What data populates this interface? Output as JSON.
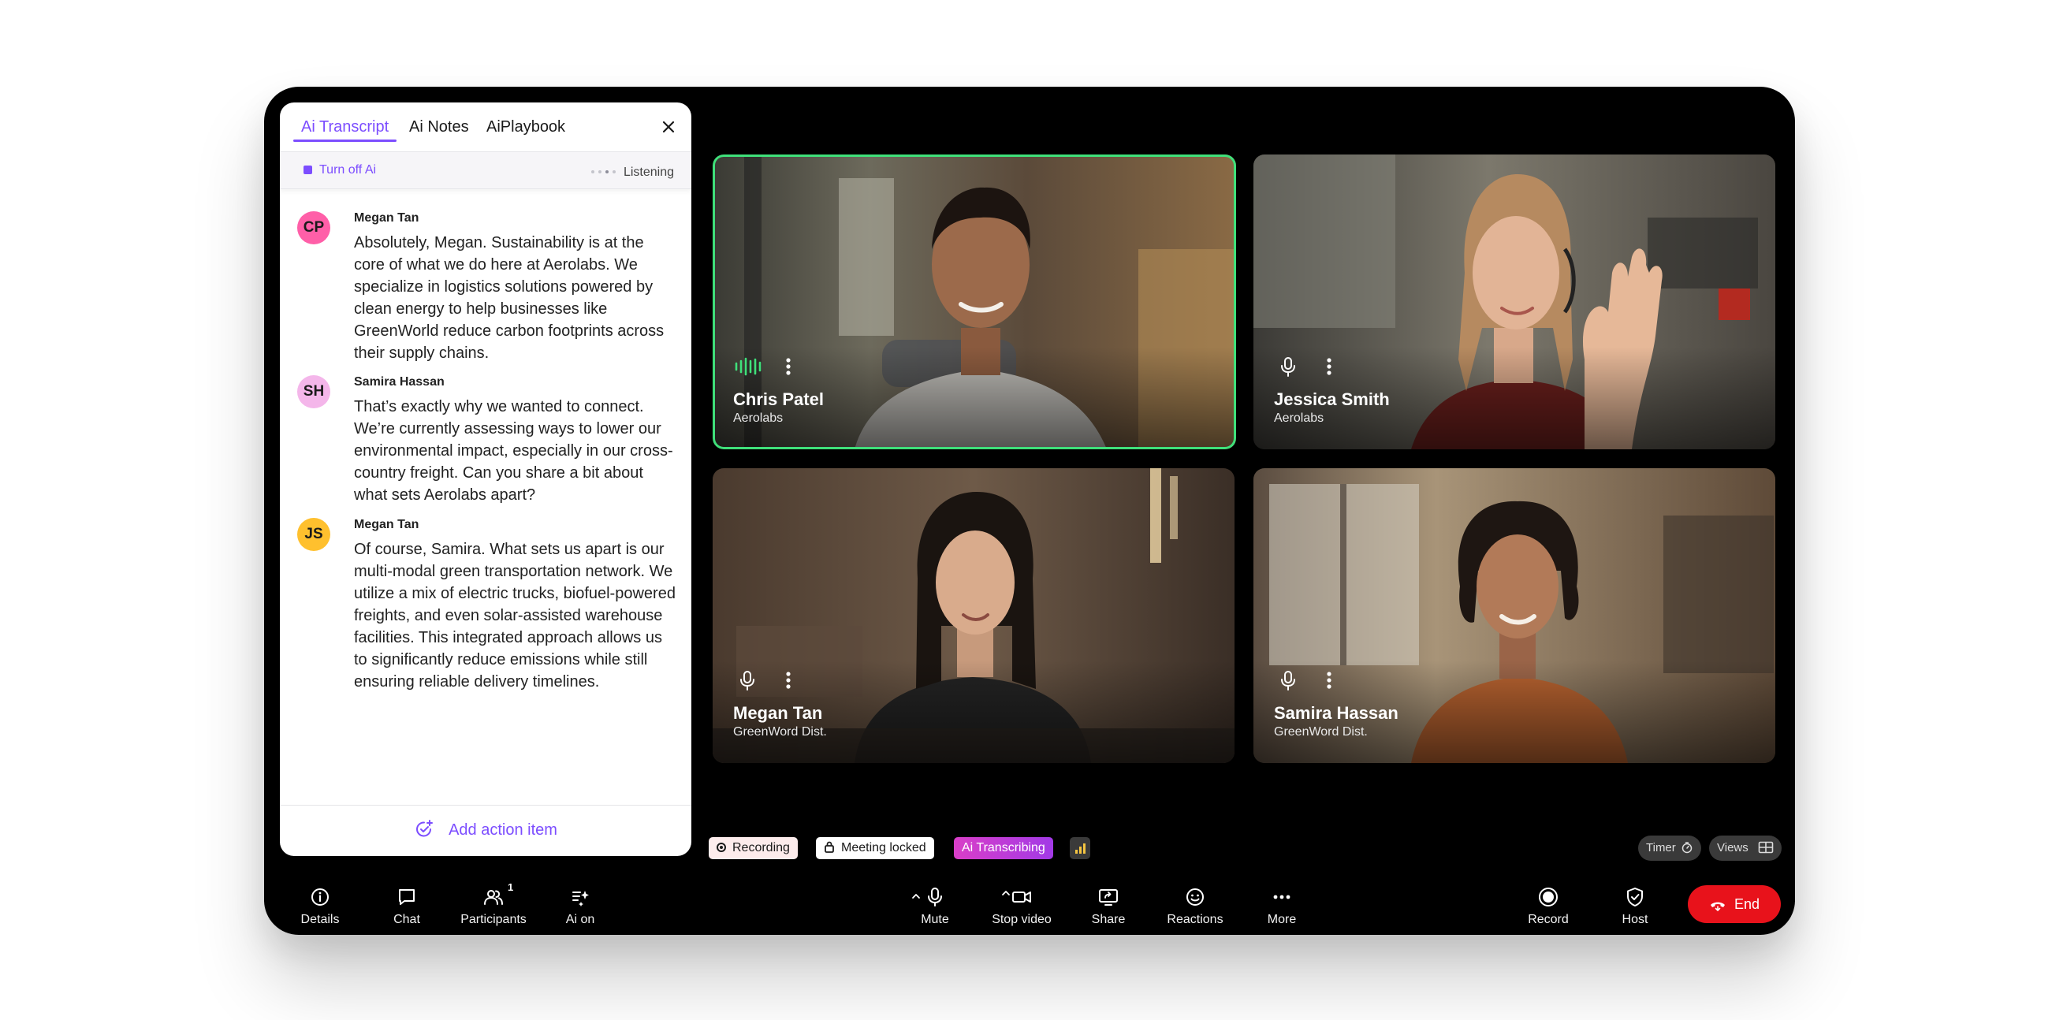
{
  "side_panel": {
    "tabs": [
      {
        "label": "Ai Transcript",
        "active": true
      },
      {
        "label": "Ai Notes",
        "active": false
      },
      {
        "label": "AiPlaybook",
        "active": false
      }
    ],
    "turn_off_label": "Turn off Ai",
    "status_label": "Listening",
    "messages": [
      {
        "initials": "CP",
        "avatar_color": "#ff5fa8",
        "speaker": "Megan Tan",
        "text": "Absolutely, Megan. Sustainability is at the core of what we do here at Aerolabs. We specialize in logistics solutions powered by clean energy to help businesses like GreenWorld reduce carbon footprints across their supply chains."
      },
      {
        "initials": "SH",
        "avatar_color": "#f4b6ea",
        "speaker": "Samira Hassan",
        "text": "That’s exactly why we wanted to connect. We’re currently assessing ways to lower our environmental impact, especially in our cross-country freight. Can you share a bit about what sets Aerolabs apart?"
      },
      {
        "initials": "JS",
        "avatar_color": "#ffc02e",
        "speaker": "Megan Tan",
        "text": "Of course, Samira. What sets us apart is our multi-modal green transportation network. We utilize a mix of electric trucks, biofuel-powered freights, and even solar-assisted warehouse facilities. This integrated approach allows us to significantly reduce emissions while still ensuring reliable delivery timelines."
      }
    ],
    "add_action_label": "Add action item"
  },
  "participants": [
    {
      "name": "Chris Patel",
      "org": "Aerolabs",
      "speaking": true
    },
    {
      "name": "Jessica Smith",
      "org": "Aerolabs",
      "speaking": false
    },
    {
      "name": "Megan Tan",
      "org": "GreenWord Dist.",
      "speaking": false
    },
    {
      "name": "Samira Hassan",
      "org": "GreenWord Dist.",
      "speaking": false
    }
  ],
  "status": {
    "recording": "Recording",
    "meeting_locked": "Meeting locked",
    "ai_transcribing": "Ai Transcribing",
    "timer": "Timer",
    "views": "Views"
  },
  "toolbar": {
    "details": "Details",
    "chat": "Chat",
    "participants": "Participants",
    "participants_count": "1",
    "ai_on": "Ai on",
    "mute": "Mute",
    "stop_video": "Stop video",
    "share": "Share",
    "reactions": "Reactions",
    "more": "More",
    "record": "Record",
    "host": "Host",
    "end": "End"
  },
  "colors": {
    "accent": "#7c4dff",
    "speaking_border": "#3fe07a",
    "end_button": "#e8121b",
    "ai_chip": "#d63fd0",
    "recording_chip": "#fdecec"
  }
}
